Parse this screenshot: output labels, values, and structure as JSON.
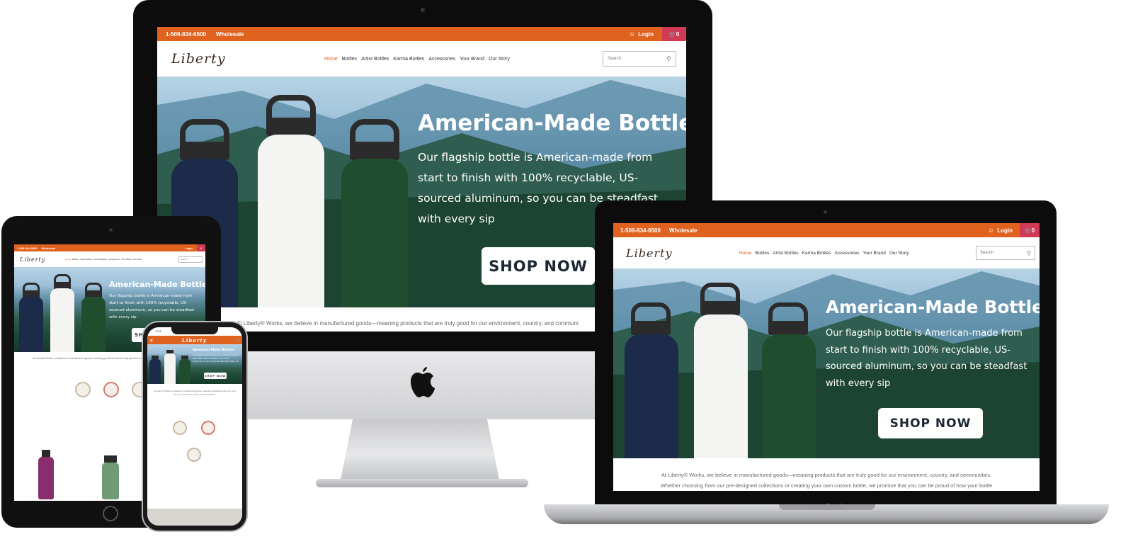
{
  "site": {
    "phone": "1-509-834-6500",
    "wholesale": "Wholesale",
    "login": "Login",
    "cart_count": "0",
    "logo": "Liberty",
    "search_placeholder": "Search",
    "nav": [
      "Home",
      "Bottles",
      "Artist Bottles",
      "Karma Bottles",
      "Accessories",
      "Your Brand",
      "Our Story"
    ],
    "hero_title": "American-Made Bottles",
    "hero_text": "Our flagship bottle is American-made from start to finish with 100% recyclable, US-sourced aluminum, so you can be steadfast with every sip",
    "shop_now": "SHOP NOW",
    "intro_line1": "At Liberty® Works, we believe in manufactured goods—meaning products that are truly good for our environment, country, and communities.",
    "intro_line2": "Whether choosing from our pre-designed collections or creating your own custom bottle, we promise that you can be proud of how your bottle",
    "imac_intro": "At Liberty® Works, we believe in manufactured goods—meaning products that are truly good for our environment, country, and communi",
    "phone_time": "3:41"
  },
  "devices": {
    "laptop_label": "MacBook"
  },
  "colors": {
    "brand_orange": "#e0621f",
    "cart_pink": "#d13a55",
    "bottle_navy": "#1c2b4a",
    "bottle_white": "#f4f4f2",
    "bottle_green": "#1f4d2e",
    "bottle_purple": "#8a2d6e",
    "bottle_sage": "#6f9a72"
  },
  "icons": [
    "user-icon",
    "cart-icon",
    "search-icon",
    "chevron-down-icon",
    "apple-logo-icon",
    "scale-icon",
    "no-bpa-icon",
    "food-grade-icon"
  ]
}
